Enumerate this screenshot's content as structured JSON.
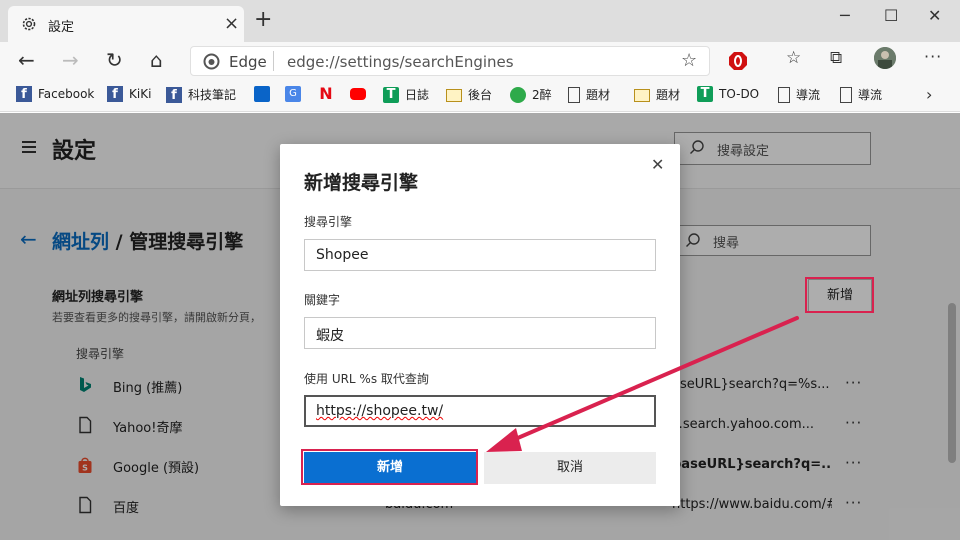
{
  "browser": {
    "tab_title": "設定",
    "new_tab_symbol": "+",
    "site_name": "Edge",
    "url": "edge://settings/searchEngines",
    "colors": {
      "highlight": "#d9224f",
      "accent": "#0a6fd1",
      "link": "#0a6cc2"
    }
  },
  "bookmarks": [
    {
      "label": "Facebook",
      "icon": "facebook-icon"
    },
    {
      "label": "KiKi",
      "icon": "facebook-icon"
    },
    {
      "label": "科技筆記",
      "icon": "facebook-icon"
    },
    {
      "label": "",
      "icon": "outlook-icon"
    },
    {
      "label": "",
      "icon": "translate-icon"
    },
    {
      "label": "",
      "icon": "netflix-icon"
    },
    {
      "label": "",
      "icon": "youtube-icon"
    },
    {
      "label": "日誌",
      "icon": "sheets-icon"
    },
    {
      "label": "後台",
      "icon": "folder-icon"
    },
    {
      "label": "2醉",
      "icon": "share-icon"
    },
    {
      "label": "題材",
      "icon": "page-icon"
    },
    {
      "label": "題材",
      "icon": "folder-icon"
    },
    {
      "label": "TO-DO",
      "icon": "sheets-icon"
    },
    {
      "label": "導流",
      "icon": "page-icon"
    },
    {
      "label": "導流",
      "icon": "page-icon"
    }
  ],
  "settings": {
    "title": "設定",
    "search_placeholder": "搜尋設定",
    "breadcrumb_parent": "網址列",
    "breadcrumb_sep": " / ",
    "breadcrumb_current": "管理搜尋引擎",
    "engine_search_placeholder": "搜尋",
    "section_title": "網址列搜尋引擎",
    "section_desc": "若要查看更多的搜尋引擎，請開啟新分頁，",
    "add_button": "新增",
    "column_header": "搜尋引擎",
    "engines": [
      {
        "name": "Bing (推薦)",
        "keyword": "",
        "url": "aseURL}search?q=%s...",
        "icon": "bing-icon"
      },
      {
        "name": "Yahoo!奇摩",
        "keyword": "",
        "url": "v.search.yahoo.com...",
        "icon": "page-icon"
      },
      {
        "name": "Google (預設)",
        "keyword": "",
        "url": "baseURL}search?q=...",
        "icon": "shopee-bag-icon"
      },
      {
        "name": "百度",
        "keyword": "baidu.com",
        "url": "https://www.baidu.com/#ie=...",
        "icon": "page-icon"
      }
    ],
    "more_symbol": "···"
  },
  "dialog": {
    "title": "新增搜尋引擎",
    "close_symbol": "✕",
    "engine_label": "搜尋引擎",
    "engine_value": "Shopee",
    "keyword_label": "關鍵字",
    "keyword_value": "蝦皮",
    "url_label": "使用 URL %s 取代查詢",
    "url_value": "https://shopee.tw/",
    "add_button": "新增",
    "cancel_button": "取消"
  }
}
